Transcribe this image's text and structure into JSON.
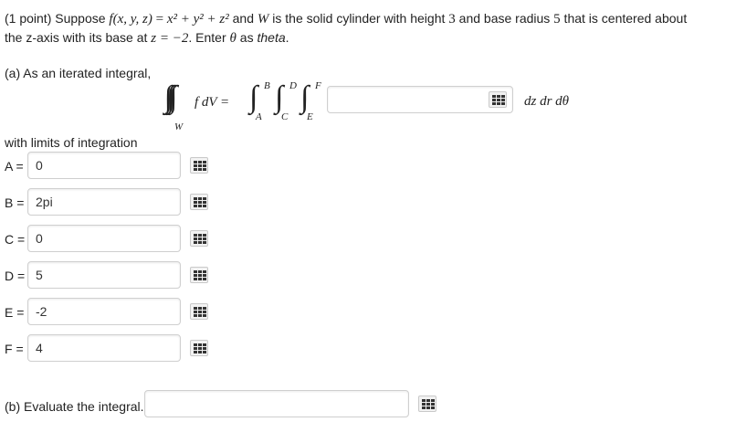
{
  "problem": {
    "points": "(1 point) Suppose ",
    "func": "f(x, y, z)",
    "eq1": " = ",
    "poly": "x² + y² + z²",
    "and_w": " and ",
    "w": "W",
    "desc1": " is the solid cylinder with height ",
    "height": "3",
    "desc2": " and base radius ",
    "radius": "5",
    "desc3": " that is centered about",
    "line2a": "the z-axis with its base at ",
    "zeq": "z = −2",
    "line2b": ". Enter ",
    "theta": "θ",
    "line2c": " as ",
    "theta_word": "theta",
    "line2d": "."
  },
  "part_a": {
    "label": "(a) As an iterated integral,",
    "integral_lhs": "f dV =",
    "region": "W",
    "limits_labels": {
      "A": "A",
      "B": "B",
      "C": "C",
      "D": "D",
      "E": "E",
      "F": "F"
    },
    "integrand_value": "",
    "differentials": "dz dr dθ"
  },
  "limits": {
    "heading": "with limits of integration",
    "rows": [
      {
        "label": "A =",
        "value": "0"
      },
      {
        "label": "B =",
        "value": "2pi"
      },
      {
        "label": "C =",
        "value": "0"
      },
      {
        "label": "D =",
        "value": "5"
      },
      {
        "label": "E =",
        "value": "-2"
      },
      {
        "label": "F =",
        "value": "4"
      }
    ]
  },
  "part_b": {
    "label": "(b) Evaluate the integral.",
    "value": ""
  },
  "icons": {
    "palette": "equation-palette-icon"
  }
}
